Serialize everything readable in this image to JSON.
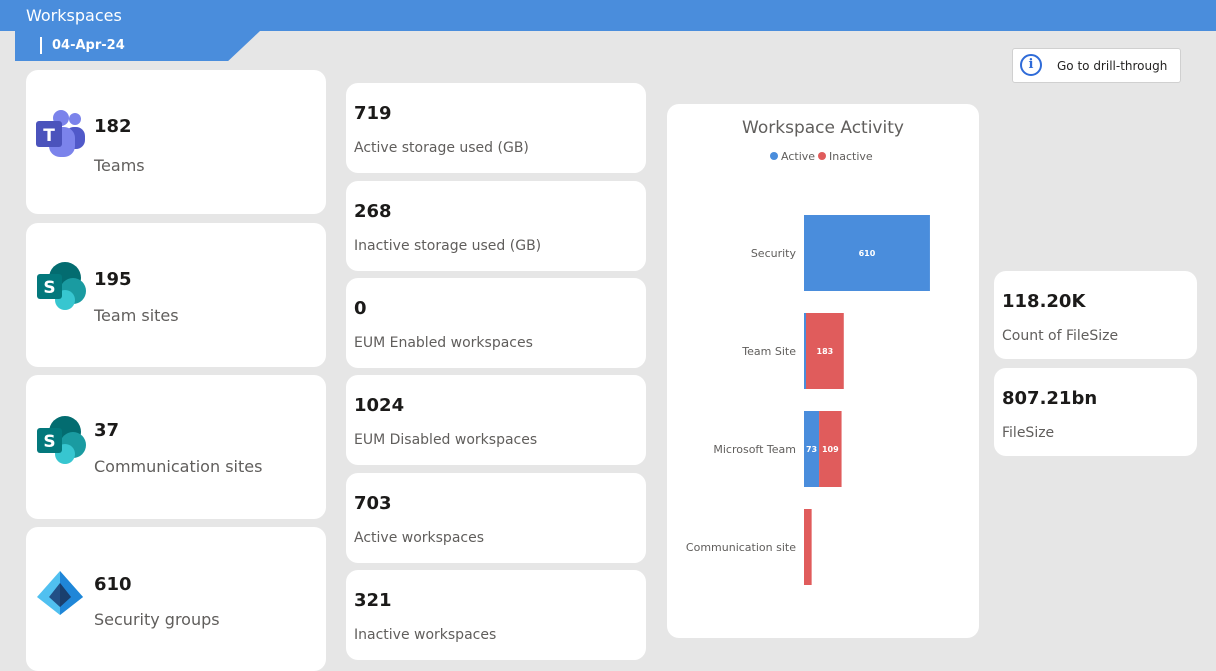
{
  "header": {
    "title": "Workspaces",
    "date": "04-Apr-24"
  },
  "drill_button": {
    "label": "Go to drill-through",
    "icon": "info-icon"
  },
  "summary_cards": [
    {
      "value": "182",
      "label": "Teams",
      "icon": "teams-icon"
    },
    {
      "value": "195",
      "label": "Team sites",
      "icon": "sharepoint-icon"
    },
    {
      "value": "37",
      "label": "Communication sites",
      "icon": "sharepoint-icon"
    },
    {
      "value": "610",
      "label": "Security groups",
      "icon": "azure-ad-icon"
    }
  ],
  "kpi_cards": [
    {
      "value": "719",
      "label": "Active storage used (GB)"
    },
    {
      "value": "268",
      "label": "Inactive storage used (GB)"
    },
    {
      "value": "0",
      "label": "EUM Enabled workspaces"
    },
    {
      "value": "1024",
      "label": "EUM Disabled workspaces"
    },
    {
      "value": "703",
      "label": "Active workspaces"
    },
    {
      "value": "321",
      "label": "Inactive workspaces"
    }
  ],
  "right_cards": [
    {
      "value": "118.20K",
      "label": "Count of FileSize"
    },
    {
      "value": "807.21bn",
      "label": "FileSize"
    }
  ],
  "colors": {
    "header": "#4a8ddc",
    "active": "#4a8ddc",
    "inactive": "#e05c5c"
  },
  "chart_data": {
    "type": "bar",
    "orientation": "horizontal",
    "stacked": true,
    "title": "Workspace Activity",
    "legend": [
      "Active",
      "Inactive"
    ],
    "legend_position": "top",
    "categories": [
      "Security",
      "Team Site",
      "Microsoft Team",
      "Communication site"
    ],
    "series": [
      {
        "name": "Active",
        "values": [
          610,
          2,
          73,
          0
        ],
        "labels": [
          "610",
          "",
          "73",
          ""
        ]
      },
      {
        "name": "Inactive",
        "values": [
          0,
          183,
          109,
          37
        ],
        "labels": [
          "",
          "183",
          "109",
          ""
        ]
      }
    ],
    "xlim": [
      0,
      620
    ]
  }
}
